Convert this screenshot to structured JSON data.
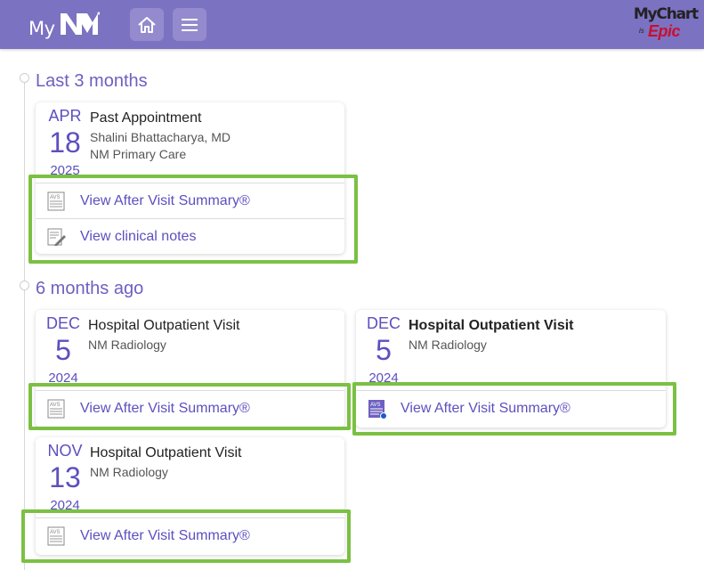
{
  "header": {
    "logo_my": "My",
    "logo_mark": "NM",
    "mychart_brand": "MyChart",
    "mychart_is": "is",
    "mychart_epic": "Epic",
    "accent": "#7c72c2"
  },
  "sections": [
    {
      "title": "Last 3 months"
    },
    {
      "title": "6 months ago"
    }
  ],
  "visits": [
    {
      "month": "APR",
      "day": "18",
      "year": "2025",
      "title": "Past Appointment",
      "provider": "Shalini Bhattacharya, MD",
      "department": "NM Primary Care",
      "actions": [
        {
          "label": "View After Visit Summary®",
          "icon": "avs-document-icon"
        },
        {
          "label": "View clinical notes",
          "icon": "clinical-notes-pencil-icon"
        }
      ]
    },
    {
      "month": "DEC",
      "day": "5",
      "year": "2024",
      "title": "Hospital Outpatient Visit",
      "department": "NM Radiology",
      "actions": [
        {
          "label": "View After Visit Summary®",
          "icon": "avs-document-icon"
        }
      ]
    },
    {
      "month": "DEC",
      "day": "5",
      "year": "2024",
      "title": "Hospital Outpatient Visit",
      "department": "NM Radiology",
      "actions": [
        {
          "label": "View After Visit Summary®",
          "icon": "avs-document-new-icon"
        }
      ]
    },
    {
      "month": "NOV",
      "day": "13",
      "year": "2024",
      "title": "Hospital Outpatient Visit",
      "department": "NM Radiology",
      "actions": [
        {
          "label": "View After Visit Summary®",
          "icon": "avs-document-icon"
        }
      ]
    }
  ]
}
